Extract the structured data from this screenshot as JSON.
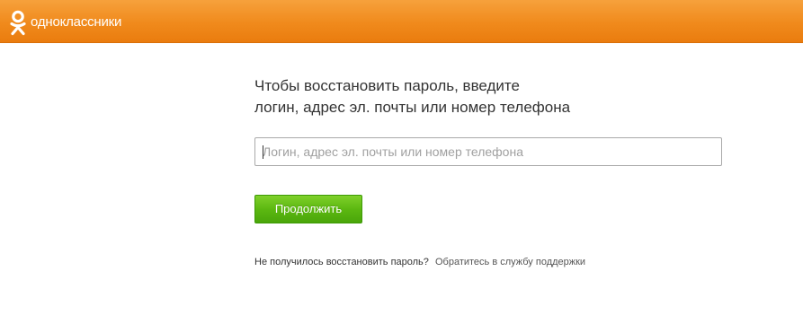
{
  "header": {
    "logo_text": "одноклассники",
    "brand_color": "#f08a1c"
  },
  "recovery": {
    "heading_line1": "Чтобы восстановить пароль, введите",
    "heading_line2": "логин, адрес эл. почты или номер телефона",
    "input_value": "",
    "input_placeholder": "Логин, адрес эл. почты или номер телефона",
    "continue_label": "Продолжить",
    "continue_color": "#5cb811",
    "help_question": "Не получилось восстановить пароль?",
    "help_link": "Обратитесь в службу поддержки"
  }
}
